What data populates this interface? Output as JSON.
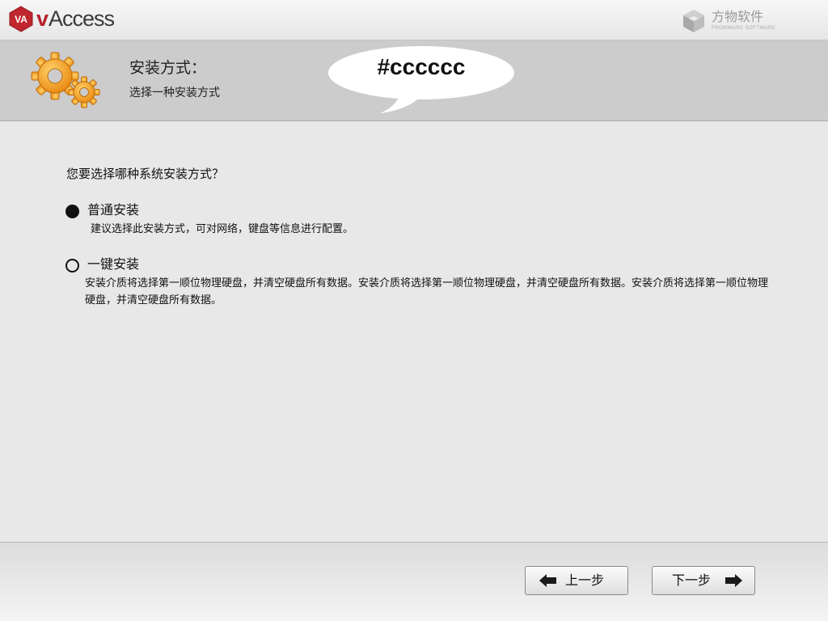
{
  "app": {
    "logo_text": "VA",
    "name_prefix": "v",
    "name_rest": "Access"
  },
  "vendor": {
    "name": "方物软件",
    "subtitle": "FROMWARE SOFTWARE"
  },
  "header": {
    "title": "安装方式：",
    "subtitle": "选择一种安装方式",
    "bubble_text": "#cccccc"
  },
  "main": {
    "question": "您要选择哪种系统安装方式？",
    "options": [
      {
        "label": "普通安装",
        "description": "建议选择此安装方式，可对网络，键盘等信息进行配置。",
        "selected": true
      },
      {
        "label": "一键安装",
        "description": "安装介质将选择第一顺位物理硬盘，并清空硬盘所有数据。安装介质将选择第一顺位物理硬盘，并清空硬盘所有数据。安装介质将选择第一顺位物理硬盘，并清空硬盘所有数据。",
        "selected": false
      }
    ]
  },
  "footer": {
    "prev_label": "上一步",
    "next_label": "下一步"
  },
  "colors": {
    "header_band": "#cccccc",
    "brand_red": "#b5202a",
    "gear_orange": "#f2a21e"
  },
  "icons": {
    "logo": "vaccess-logo-icon",
    "vendor": "vendor-cube-icon",
    "gears": "gears-icon",
    "prev": "arrow-left-icon",
    "next": "arrow-right-icon"
  }
}
